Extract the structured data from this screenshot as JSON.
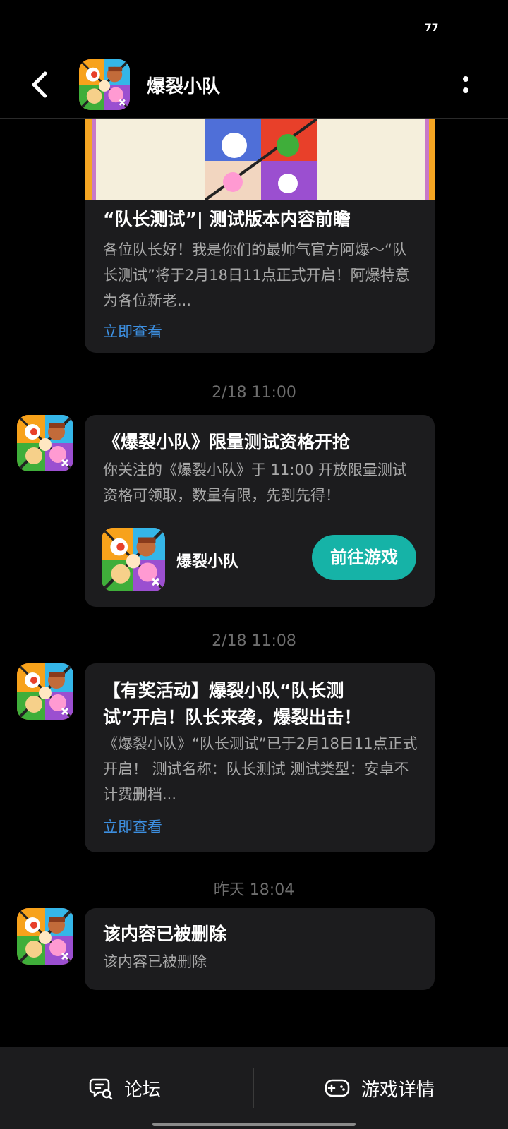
{
  "status_bar": {
    "indicator": "77"
  },
  "header": {
    "title": "爆裂小队",
    "back_icon": "chevron-left-icon",
    "more_icon": "more-vertical-icon"
  },
  "messages": [
    {
      "title": "“队长测试”| 测试版本内容前瞻",
      "body": "各位队长好！我是你们的最帅气官方阿爆～“队长测试”将于2月18日11点正式开启！阿爆特意为各位新老...",
      "link": "立即查看"
    },
    {
      "time": "2/18  11:00",
      "title": "《爆裂小队》限量测试资格开抢",
      "body": "你关注的《爆裂小队》于 11:00 开放限量测试资格可领取，数量有限，先到先得！",
      "game_name": "爆裂小队",
      "button": "前往游戏"
    },
    {
      "time": "2/18  11:08",
      "title": "【有奖活动】爆裂小队“队长测试”开启！队长来袭，爆裂出击！",
      "body": "《爆裂小队》“队长测试”已于2月18日11点正式开启！ 测试名称：队长测试 测试类型：安卓不计费删档...",
      "link": "立即查看"
    },
    {
      "time": "昨天  18:04",
      "title": "该内容已被删除",
      "body": "该内容已被删除"
    }
  ],
  "bottom_bar": {
    "forum": {
      "label": "论坛",
      "icon": "forum-chat-icon"
    },
    "game_details": {
      "label": "游戏详情",
      "icon": "gamepad-icon"
    }
  },
  "colors": {
    "accent_teal": "#16b3a7",
    "link_blue": "#3d8fe0",
    "card_bg": "#1c1c1e"
  }
}
